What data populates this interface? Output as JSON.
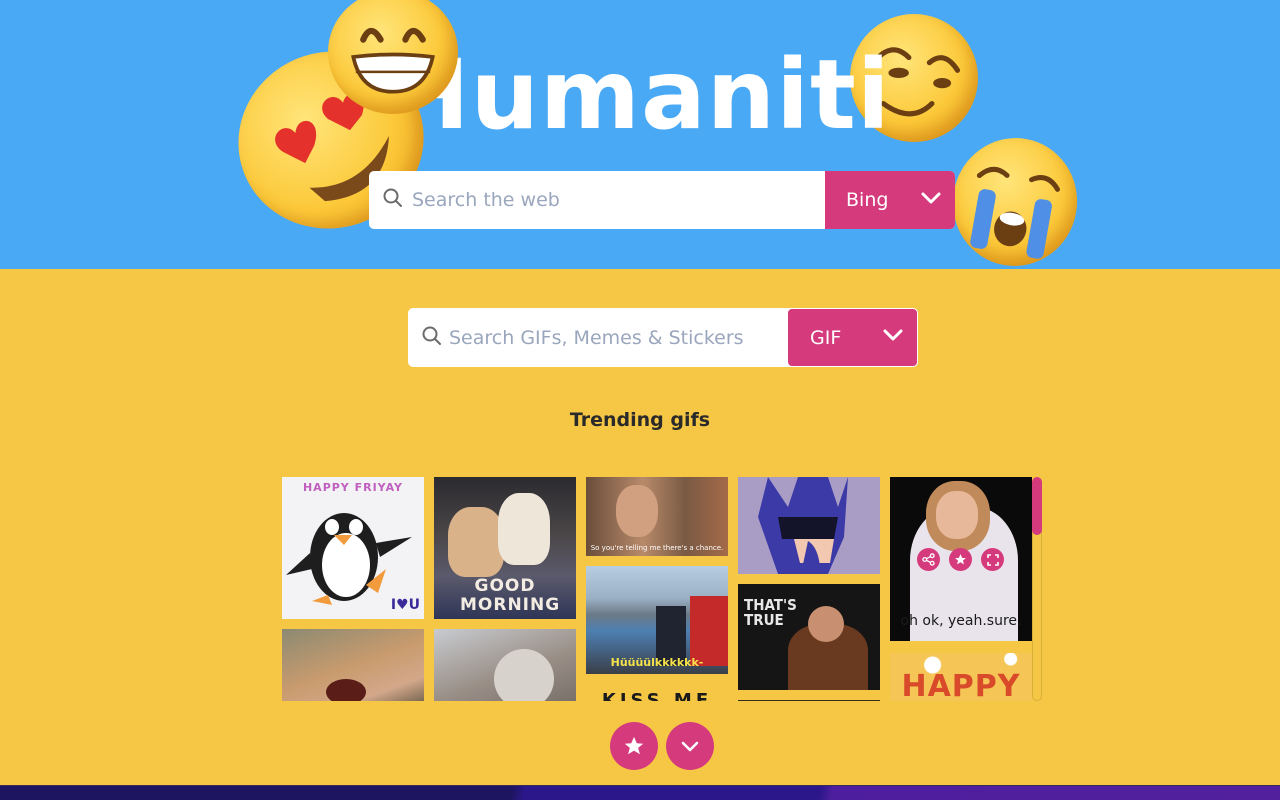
{
  "brand": {
    "title": "Humaniti"
  },
  "web_search": {
    "placeholder": "Search the web",
    "value": "",
    "engine": "Bing",
    "search_icon": "search-icon",
    "dropdown_icon": "chevron-down-icon"
  },
  "gif_search": {
    "placeholder": "Search GIFs, Memes & Stickers",
    "value": "",
    "type": "GIF",
    "search_icon": "search-icon",
    "dropdown_icon": "chevron-down-icon"
  },
  "trending": {
    "title": "Trending gifs",
    "items": [
      {
        "name": "penguin-happy-friyay",
        "caption": "HAPPY FRIYAY",
        "sub": "I♥U"
      },
      {
        "name": "chihuahuas-good-morning",
        "caption": "GOOD MORNING",
        "sub": ""
      },
      {
        "name": "leo-laughing",
        "caption": "",
        "sub": ""
      },
      {
        "name": "cats-cuddling",
        "caption": "",
        "sub": ""
      },
      {
        "name": "dumb-and-dumber-chance",
        "caption": "So you're telling me there's a chance.",
        "sub": ""
      },
      {
        "name": "f1-driver-waving",
        "caption": "Hüüüülkkkkkk-",
        "sub": ""
      },
      {
        "name": "kiss-me-text",
        "caption": "KISS ME",
        "sub": ""
      },
      {
        "name": "batman-thinking",
        "caption": "",
        "sub": ""
      },
      {
        "name": "kramer-thats-true",
        "caption": "THAT'S TRUE",
        "sub": ""
      },
      {
        "name": "dark-gif",
        "caption": "",
        "sub": ""
      },
      {
        "name": "jennifer-oh-ok-yeah-sure",
        "caption": "oh ok, yeah.sure.",
        "sub": ""
      },
      {
        "name": "happy-orange",
        "caption": "HAPPY",
        "sub": ""
      }
    ],
    "hover_actions": [
      "share",
      "favorite",
      "fullscreen"
    ],
    "scroll_fraction": 0.0
  },
  "bottom_actions": {
    "favorites": "star-icon",
    "expand": "chevron-down-icon"
  },
  "colors": {
    "hero_bg": "#4aa9f5",
    "body_bg": "#f6c744",
    "accent": "#d53a7c",
    "footer": "#2b178a"
  }
}
